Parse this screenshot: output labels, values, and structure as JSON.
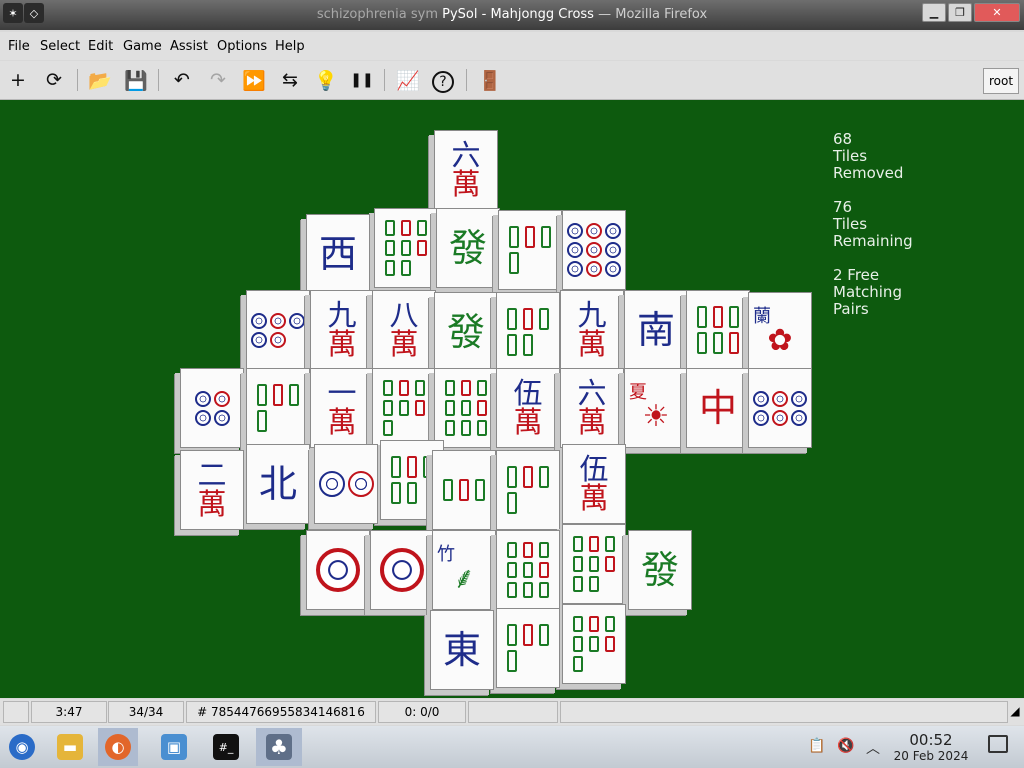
{
  "window": {
    "title_back": "schizophrenia sym",
    "title_mid": "PySol - Mahjongg Cross",
    "title_suffix": "— Mozilla Firefox",
    "title_back_icon": "kde-app-icon",
    "title_menu_icon": "diamond-menu-icon"
  },
  "menu": {
    "items": [
      "File",
      "Select",
      "Edit",
      "Game",
      "Assist",
      "Options",
      "Help"
    ]
  },
  "toolbar": {
    "buttons": [
      {
        "name": "new-game",
        "glyph": "+"
      },
      {
        "name": "restart",
        "glyph": "⟳"
      },
      {
        "name": "open",
        "glyph": "📂"
      },
      {
        "name": "save",
        "glyph": "💾"
      },
      {
        "name": "undo",
        "glyph": "↶"
      },
      {
        "name": "redo",
        "glyph": "↷",
        "disabled": true
      },
      {
        "name": "autodrop",
        "glyph": "⏩",
        "disabled": true
      },
      {
        "name": "shuffle",
        "glyph": "⇆"
      },
      {
        "name": "hint",
        "glyph": "💡"
      },
      {
        "name": "pause",
        "glyph": "❚❚"
      },
      {
        "name": "statistics",
        "glyph": "📈"
      },
      {
        "name": "rules",
        "glyph": "?"
      },
      {
        "name": "quit",
        "glyph": "🚪"
      }
    ],
    "player": "root"
  },
  "game": {
    "info": {
      "removed": "68\nTiles\nRemoved",
      "remaining": "76\nTiles\nRemaining",
      "pairs": "2 Free\nMatching\nPairs"
    },
    "tiles": [
      {
        "type": "char",
        "num": "六",
        "suit": "萬"
      },
      {
        "type": "char",
        "num": "西",
        "suit": "",
        "color": "blue"
      },
      {
        "type": "bamboo",
        "count": 8
      },
      {
        "type": "dragon",
        "num": "發",
        "color": "green"
      },
      {
        "type": "bamboo",
        "count": 4
      },
      {
        "type": "circles",
        "count": 9
      },
      {
        "type": "circles",
        "count": 5
      },
      {
        "type": "char",
        "num": "九",
        "suit": "萬"
      },
      {
        "type": "char",
        "num": "八",
        "suit": "萬"
      },
      {
        "type": "dragon",
        "num": "發",
        "color": "green"
      },
      {
        "type": "bamboo",
        "count": 5
      },
      {
        "type": "char",
        "num": "九",
        "suit": "萬"
      },
      {
        "type": "wind",
        "num": "南",
        "color": "blue"
      },
      {
        "type": "bamboo",
        "count": 6
      },
      {
        "type": "flower",
        "num": "蘭",
        "sub": "✿"
      },
      {
        "type": "circles",
        "count": 4
      },
      {
        "type": "bamboo",
        "count": 4
      },
      {
        "type": "char",
        "num": "一",
        "suit": "萬"
      },
      {
        "type": "bamboo",
        "count": 7
      },
      {
        "type": "bamboo",
        "count": 9
      },
      {
        "type": "char",
        "num": "伍",
        "suit": "萬"
      },
      {
        "type": "char",
        "num": "六",
        "suit": "萬"
      },
      {
        "type": "season",
        "num": "夏",
        "sub": "☀"
      },
      {
        "type": "dragon",
        "num": "中",
        "color": "red"
      },
      {
        "type": "circles",
        "count": 6
      },
      {
        "type": "char",
        "num": "二",
        "suit": "萬"
      },
      {
        "type": "wind",
        "num": "北",
        "color": "blue"
      },
      {
        "type": "circles",
        "count": 2
      },
      {
        "type": "bamboo",
        "count": 5
      },
      {
        "type": "bamboo",
        "count": 3
      },
      {
        "type": "bamboo",
        "count": 4
      },
      {
        "type": "char",
        "num": "伍",
        "suit": "萬"
      },
      {
        "type": "circles",
        "count": 1
      },
      {
        "type": "circles",
        "count": 1
      },
      {
        "type": "bamboo1",
        "num": "竹"
      },
      {
        "type": "bamboo",
        "count": 9
      },
      {
        "type": "bamboo",
        "count": 8
      },
      {
        "type": "dragon",
        "num": "發",
        "color": "green"
      },
      {
        "type": "wind",
        "num": "東",
        "color": "blue"
      },
      {
        "type": "bamboo",
        "count": 4
      },
      {
        "type": "bamboo",
        "count": 7
      }
    ]
  },
  "status": {
    "time": "3:47",
    "moves": "34/34",
    "game_number": "# 7854476695583414681 6",
    "score": "0: 0/0",
    "empty1": "",
    "empty2": ""
  },
  "taskbar": {
    "apps": [
      {
        "name": "start",
        "glyph": "◉",
        "color": "#2a6bc7"
      },
      {
        "name": "files",
        "glyph": "▬",
        "color": "#e5b53a"
      },
      {
        "name": "firefox",
        "glyph": "◐",
        "color": "#e2662a"
      },
      {
        "name": "system",
        "glyph": "▣",
        "color": "#4a8fd1"
      },
      {
        "name": "terminal",
        "glyph": "#_",
        "color": "#111111"
      },
      {
        "name": "pysol",
        "glyph": "♣",
        "color": "#5f6f88"
      }
    ],
    "clock_time": "00:52",
    "clock_date": "20 Feb 2024"
  },
  "colors": {
    "felt": "#0d5a0e",
    "char_red": "#c0141c",
    "wind_blue": "#1e2c8a",
    "bamboo_green": "#1a7a25"
  }
}
